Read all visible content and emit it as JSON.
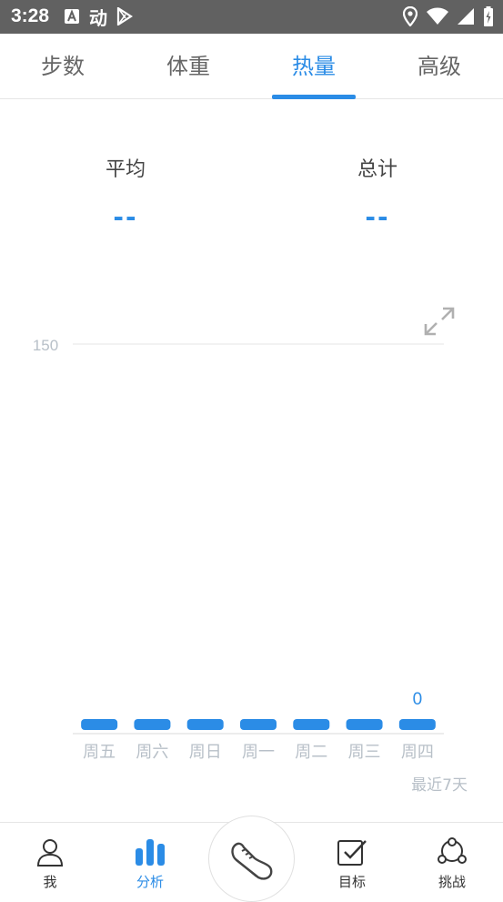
{
  "status_bar": {
    "time": "3:28",
    "left_icons": [
      "a-box-icon",
      "dong-app-icon",
      "play-store-icon"
    ],
    "right_icons": [
      "location-icon",
      "wifi-icon",
      "signal-icon",
      "battery-icon"
    ],
    "app_icon_text": "动"
  },
  "tabs": [
    {
      "label": "步数",
      "active": false
    },
    {
      "label": "体重",
      "active": false
    },
    {
      "label": "热量",
      "active": true
    },
    {
      "label": "高级",
      "active": false
    }
  ],
  "stats": {
    "average_label": "平均",
    "average_value": "--",
    "total_label": "总计",
    "total_value": "--"
  },
  "chart_data": {
    "type": "bar",
    "categories": [
      "周五",
      "周六",
      "周日",
      "周一",
      "周二",
      "周三",
      "周四"
    ],
    "values": [
      0,
      0,
      0,
      0,
      0,
      0,
      0
    ],
    "ylim": [
      0,
      150
    ],
    "yticks": [
      "150"
    ],
    "value_label": "0",
    "footer": "最近7天",
    "bar_color": "#2b8ce6",
    "grid": true
  },
  "bottom_nav": [
    {
      "label": "我",
      "icon": "person-icon",
      "active": false
    },
    {
      "label": "分析",
      "icon": "bar-chart-icon",
      "active": true
    },
    {
      "label": "",
      "icon": "shoe-icon",
      "active": false
    },
    {
      "label": "目标",
      "icon": "checkbox-icon",
      "active": false
    },
    {
      "label": "挑战",
      "icon": "share-nodes-icon",
      "active": false
    }
  ],
  "colors": {
    "accent": "#2b8ce6",
    "status_bar": "#616161"
  }
}
